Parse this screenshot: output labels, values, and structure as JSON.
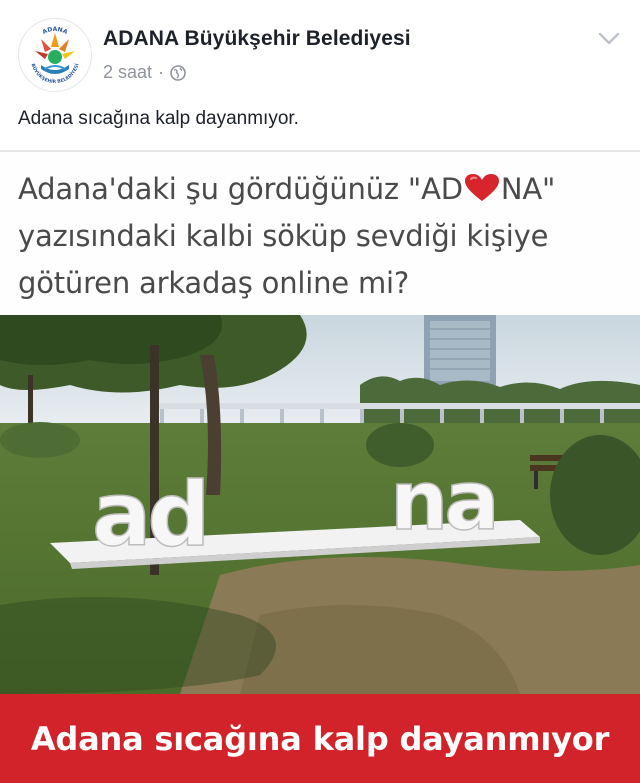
{
  "post": {
    "page_name": "ADANA Büyükşehir Belediyesi",
    "time": "2 saat",
    "separator": "·",
    "privacy_icon": "globe-icon",
    "menu_icon": "chevron-down-icon",
    "caption": "Adana sıcağına kalp dayanmıyor.",
    "avatar": {
      "logo_top_text": "ADANA",
      "logo_bottom_text": "BÜYÜKŞEHİR BELEDİYESİ"
    }
  },
  "image": {
    "headline": {
      "line1_before": "Adana'daki şu gördüğünüz \"AD",
      "line1_after": "NA\"",
      "line2": "yazısındaki kalbi söküp sevdiği kişiye",
      "line3": "götüren arkadaş online mi?"
    },
    "sign_letters": {
      "left": "ad",
      "right": "na"
    },
    "banner_text": "Adana sıcağına kalp dayanmıyor"
  },
  "colors": {
    "page_name": "#1d2129",
    "meta": "#90949c",
    "banner": "#d2232a",
    "heart": "#d6262c"
  }
}
